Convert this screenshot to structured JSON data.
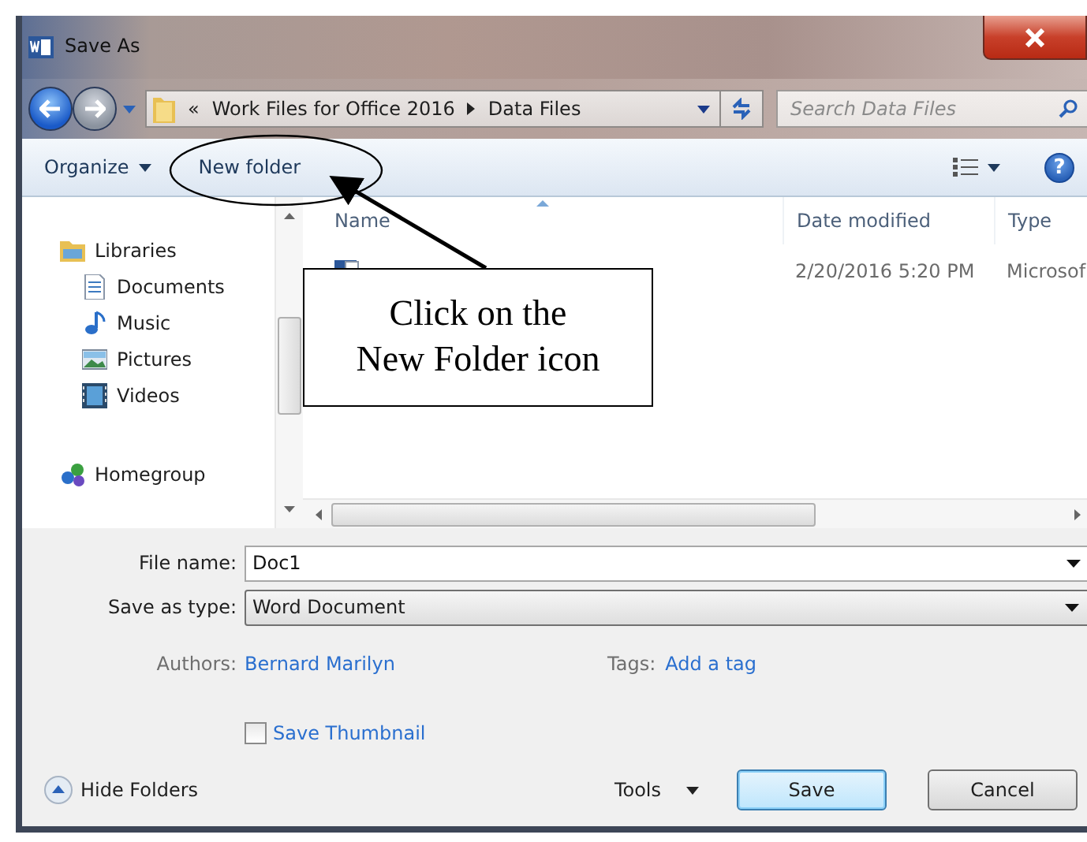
{
  "window": {
    "title": "Save As"
  },
  "breadcrumb": {
    "prefix": "«",
    "segments": [
      "Work Files for Office 2016",
      "Data Files"
    ]
  },
  "search": {
    "placeholder": "Search Data Files"
  },
  "toolbar": {
    "organize": "Organize",
    "new_folder": "New folder",
    "help": "?"
  },
  "nav_pane": {
    "items": [
      {
        "label": "Libraries",
        "kind": "libraries",
        "children": [
          {
            "label": "Documents",
            "kind": "documents"
          },
          {
            "label": "Music",
            "kind": "music"
          },
          {
            "label": "Pictures",
            "kind": "pictures"
          },
          {
            "label": "Videos",
            "kind": "videos"
          }
        ]
      },
      {
        "label": "Homegroup",
        "kind": "homegroup"
      }
    ]
  },
  "file_list": {
    "columns": [
      {
        "label": "Name",
        "sorted": true
      },
      {
        "label": "Date modified",
        "sorted": false
      },
      {
        "label": "Type",
        "sorted": false
      }
    ],
    "rows": [
      {
        "kind": "word",
        "date": "2/20/2016 5:20 PM",
        "type": "Microsof"
      }
    ]
  },
  "form": {
    "file_name_label": "File name:",
    "file_name": "Doc1",
    "type_label": "Save as type:",
    "type": "Word Document",
    "authors_label": "Authors:",
    "authors": "Bernard Marilyn",
    "tags_label": "Tags:",
    "tags": "Add a tag",
    "thumbnail_label": "Save Thumbnail",
    "thumbnail_checked": false
  },
  "footer": {
    "hide_folders": "Hide Folders",
    "tools": "Tools",
    "buttons": [
      "Save",
      "Cancel"
    ]
  },
  "annotation": {
    "callout": [
      "Click on the",
      "New Folder icon"
    ]
  }
}
